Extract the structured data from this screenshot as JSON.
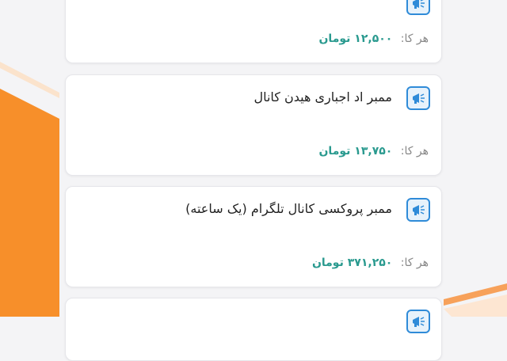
{
  "cards": [
    {
      "title": "",
      "price_label": "هر کا:",
      "price_value": "۱۲,۵۰۰ تومان",
      "icon": "megaphone-icon"
    },
    {
      "title": "ممبر اد اجباری هیدن کانال",
      "price_label": "هر کا:",
      "price_value": "۱۳,۷۵۰ تومان",
      "icon": "megaphone-icon"
    },
    {
      "title": "ممبر پروکسی کانال تلگرام (یک ساعته)",
      "price_label": "هر کا:",
      "price_value": "۳۷۱,۲۵۰ تومان",
      "icon": "megaphone-icon"
    },
    {
      "title": "",
      "price_label": "",
      "price_value": "",
      "icon": "megaphone-icon"
    }
  ],
  "colors": {
    "accent_orange": "#f78f2a",
    "price_teal": "#2a9a8f",
    "icon_blue": "#2f8bd8"
  }
}
